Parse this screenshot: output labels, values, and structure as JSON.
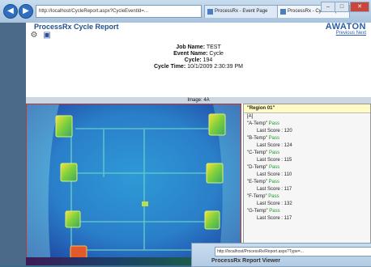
{
  "browser": {
    "address": "http://localhost/CycleReport.aspx?CycleEventId=...",
    "tab1": "ProcessRx - Event Page",
    "tab2": "ProcessRx - Cycle Report",
    "back_label": "◀",
    "forward_label": "▶"
  },
  "page": {
    "title": "ProcessRx Cycle Report",
    "logo": "AWATON",
    "links": "Previous Next"
  },
  "report": {
    "job_label": "Job Name:",
    "job_value": "TEST",
    "event_label": "Event Name:",
    "event_value": "Cycle",
    "cycle_label": "Cycle:",
    "cycle_value": "194",
    "time_label": "Cycle Time:",
    "time_value": "10/1/2009 2:30:39 PM",
    "image_label": "Image: 4A"
  },
  "sidebar": {
    "header": "\"Region 01\"",
    "section": "[A]",
    "items": [
      {
        "name": "\"A-Temp\"",
        "status": "Pass",
        "score": "Last Score : 120"
      },
      {
        "name": "\"B-Temp\"",
        "status": "Pass",
        "score": "Last Score : 124"
      },
      {
        "name": "\"C-Temp\"",
        "status": "Pass",
        "score": "Last Score : 115"
      },
      {
        "name": "\"D-Temp\"",
        "status": "Pass",
        "score": "Last Score : 110"
      },
      {
        "name": "\"E-Temp\"",
        "status": "Pass",
        "score": "Last Score : 117"
      },
      {
        "name": "\"F-Temp\"",
        "status": "Pass",
        "score": "Last Score : 132"
      },
      {
        "name": "\"G-Temp\"",
        "status": "Pass",
        "score": "Last Score : 117"
      }
    ]
  },
  "popup": {
    "address": "http://localhost/ProcessRx/Report.aspx?Type=...",
    "title": "ProcessRx Report Viewer"
  },
  "colors": {
    "accent": "#2a5ea8",
    "pass": "#1a9a2a",
    "frame": "#c0392b"
  }
}
